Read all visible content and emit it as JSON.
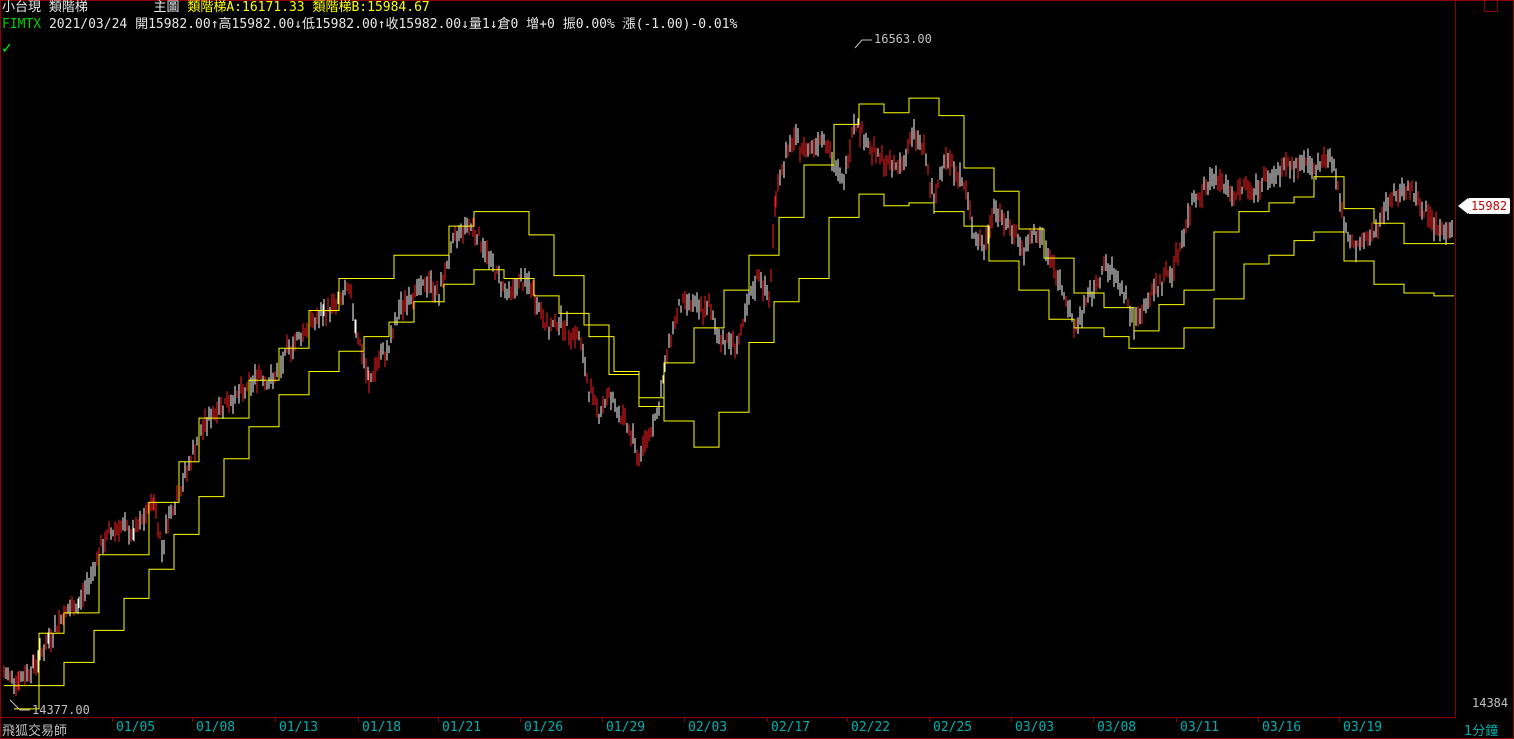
{
  "header": {
    "symbol": "小台現",
    "indicator_name": "類階梯",
    "panel": "主圖",
    "ind_a": "類階梯A:16171.33",
    "ind_b": "類階梯B:15984.67",
    "ticker": "FIMTX",
    "date": "2021/03/24",
    "open": "開15982.00",
    "high": "高15982.00",
    "low": "低15982.00",
    "close": "收15982.00",
    "vol": "量1",
    "oi": "倉0",
    "oi_chg": "增+0",
    "amp": "振0.00%",
    "chg": "漲(-1.00)-0.01%"
  },
  "footer": {
    "brand": "飛狐交易師",
    "interval": "1分鐘"
  },
  "annotations": {
    "high_label": "16563.00",
    "low_label": "14377.00",
    "last_price": "15982",
    "axis_bottom": "14384"
  },
  "colors": {
    "background": "#000000",
    "candle_up": "#ffffff",
    "candle_down": "#ff2020",
    "step_line": "#ffff00",
    "frame": "#8b0000",
    "date_text": "#00b0b0"
  },
  "chart_data": {
    "type": "line",
    "title": "",
    "x_labels": [
      "01/05",
      "01/08",
      "01/13",
      "01/18",
      "01/21",
      "01/26",
      "01/29",
      "02/03",
      "02/17",
      "02/22",
      "02/25",
      "03/03",
      "03/08",
      "03/11",
      "03/16",
      "03/19"
    ],
    "ylim": [
      14330,
      16620
    ],
    "price_series": [
      [
        0,
        14440
      ],
      [
        15,
        14420
      ],
      [
        30,
        14470
      ],
      [
        45,
        14560
      ],
      [
        60,
        14650
      ],
      [
        75,
        14680
      ],
      [
        85,
        14760
      ],
      [
        95,
        14860
      ],
      [
        105,
        14920
      ],
      [
        115,
        14950
      ],
      [
        130,
        14920
      ],
      [
        145,
        15000
      ],
      [
        150,
        15040
      ],
      [
        158,
        14870
      ],
      [
        165,
        14990
      ],
      [
        175,
        15060
      ],
      [
        185,
        15160
      ],
      [
        195,
        15260
      ],
      [
        205,
        15320
      ],
      [
        215,
        15360
      ],
      [
        225,
        15380
      ],
      [
        235,
        15400
      ],
      [
        245,
        15420
      ],
      [
        255,
        15480
      ],
      [
        265,
        15440
      ],
      [
        275,
        15480
      ],
      [
        285,
        15560
      ],
      [
        295,
        15600
      ],
      [
        305,
        15640
      ],
      [
        320,
        15680
      ],
      [
        335,
        15720
      ],
      [
        345,
        15760
      ],
      [
        352,
        15640
      ],
      [
        358,
        15540
      ],
      [
        365,
        15440
      ],
      [
        375,
        15520
      ],
      [
        385,
        15560
      ],
      [
        395,
        15690
      ],
      [
        405,
        15740
      ],
      [
        415,
        15760
      ],
      [
        425,
        15790
      ],
      [
        435,
        15740
      ],
      [
        445,
        15880
      ],
      [
        455,
        15960
      ],
      [
        465,
        15990
      ],
      [
        475,
        15940
      ],
      [
        485,
        15870
      ],
      [
        495,
        15800
      ],
      [
        505,
        15740
      ],
      [
        515,
        15790
      ],
      [
        525,
        15780
      ],
      [
        535,
        15700
      ],
      [
        545,
        15620
      ],
      [
        555,
        15660
      ],
      [
        565,
        15620
      ],
      [
        575,
        15600
      ],
      [
        585,
        15420
      ],
      [
        595,
        15340
      ],
      [
        605,
        15400
      ],
      [
        615,
        15340
      ],
      [
        625,
        15280
      ],
      [
        635,
        15180
      ],
      [
        645,
        15270
      ],
      [
        655,
        15360
      ],
      [
        665,
        15580
      ],
      [
        675,
        15700
      ],
      [
        685,
        15720
      ],
      [
        695,
        15690
      ],
      [
        705,
        15700
      ],
      [
        715,
        15600
      ],
      [
        725,
        15580
      ],
      [
        735,
        15580
      ],
      [
        745,
        15720
      ],
      [
        755,
        15820
      ],
      [
        765,
        15720
      ],
      [
        772,
        16100
      ],
      [
        780,
        16200
      ],
      [
        790,
        16280
      ],
      [
        800,
        16240
      ],
      [
        810,
        16260
      ],
      [
        820,
        16300
      ],
      [
        830,
        16180
      ],
      [
        840,
        16130
      ],
      [
        850,
        16350
      ],
      [
        860,
        16290
      ],
      [
        870,
        16230
      ],
      [
        880,
        16200
      ],
      [
        890,
        16180
      ],
      [
        900,
        16210
      ],
      [
        910,
        16300
      ],
      [
        920,
        16240
      ],
      [
        930,
        16050
      ],
      [
        940,
        16230
      ],
      [
        950,
        16180
      ],
      [
        960,
        16120
      ],
      [
        970,
        15960
      ],
      [
        980,
        15900
      ],
      [
        990,
        16050
      ],
      [
        1000,
        15990
      ],
      [
        1010,
        15970
      ],
      [
        1020,
        15880
      ],
      [
        1030,
        15960
      ],
      [
        1040,
        15920
      ],
      [
        1050,
        15830
      ],
      [
        1060,
        15760
      ],
      [
        1070,
        15620
      ],
      [
        1080,
        15700
      ],
      [
        1090,
        15760
      ],
      [
        1100,
        15840
      ],
      [
        1110,
        15810
      ],
      [
        1120,
        15760
      ],
      [
        1130,
        15640
      ],
      [
        1140,
        15700
      ],
      [
        1150,
        15760
      ],
      [
        1160,
        15800
      ],
      [
        1170,
        15840
      ],
      [
        1180,
        15960
      ],
      [
        1190,
        16080
      ],
      [
        1200,
        16110
      ],
      [
        1210,
        16150
      ],
      [
        1220,
        16120
      ],
      [
        1230,
        16080
      ],
      [
        1240,
        16120
      ],
      [
        1250,
        16100
      ],
      [
        1260,
        16140
      ],
      [
        1270,
        16150
      ],
      [
        1280,
        16190
      ],
      [
        1290,
        16180
      ],
      [
        1300,
        16200
      ],
      [
        1310,
        16160
      ],
      [
        1320,
        16230
      ],
      [
        1330,
        16190
      ],
      [
        1340,
        15980
      ],
      [
        1350,
        15900
      ],
      [
        1360,
        15920
      ],
      [
        1370,
        15960
      ],
      [
        1380,
        16040
      ],
      [
        1390,
        16080
      ],
      [
        1400,
        16120
      ],
      [
        1410,
        16090
      ],
      [
        1420,
        16040
      ],
      [
        1430,
        15980
      ],
      [
        1440,
        15960
      ],
      [
        1450,
        15982
      ]
    ],
    "step_a": [
      [
        0,
        14400
      ],
      [
        35,
        14580
      ],
      [
        60,
        14650
      ],
      [
        95,
        14850
      ],
      [
        145,
        15030
      ],
      [
        175,
        15170
      ],
      [
        195,
        15320
      ],
      [
        245,
        15450
      ],
      [
        275,
        15560
      ],
      [
        305,
        15690
      ],
      [
        335,
        15800
      ],
      [
        390,
        15880
      ],
      [
        445,
        15980
      ],
      [
        470,
        16030
      ],
      [
        525,
        15950
      ],
      [
        550,
        15810
      ],
      [
        580,
        15640
      ],
      [
        605,
        15470
      ],
      [
        635,
        15360
      ],
      [
        660,
        15510
      ],
      [
        690,
        15630
      ],
      [
        720,
        15760
      ],
      [
        745,
        15880
      ],
      [
        775,
        16010
      ],
      [
        800,
        16190
      ],
      [
        830,
        16330
      ],
      [
        855,
        16400
      ],
      [
        880,
        16370
      ],
      [
        905,
        16420
      ],
      [
        935,
        16360
      ],
      [
        960,
        16180
      ],
      [
        990,
        16100
      ],
      [
        1015,
        15970
      ],
      [
        1040,
        15870
      ],
      [
        1070,
        15750
      ],
      [
        1100,
        15700
      ],
      [
        1130,
        15620
      ],
      [
        1155,
        15710
      ],
      [
        1180,
        15760
      ],
      [
        1210,
        15960
      ],
      [
        1235,
        16030
      ],
      [
        1265,
        16060
      ],
      [
        1290,
        16080
      ],
      [
        1310,
        16150
      ],
      [
        1340,
        16040
      ],
      [
        1370,
        15990
      ],
      [
        1400,
        15920
      ],
      [
        1450,
        15920
      ]
    ],
    "step_b": [
      [
        10,
        14320
      ],
      [
        35,
        14400
      ],
      [
        60,
        14480
      ],
      [
        90,
        14590
      ],
      [
        120,
        14700
      ],
      [
        145,
        14800
      ],
      [
        170,
        14920
      ],
      [
        195,
        15050
      ],
      [
        220,
        15180
      ],
      [
        245,
        15290
      ],
      [
        275,
        15400
      ],
      [
        305,
        15480
      ],
      [
        335,
        15550
      ],
      [
        360,
        15600
      ],
      [
        385,
        15650
      ],
      [
        410,
        15720
      ],
      [
        440,
        15780
      ],
      [
        470,
        15830
      ],
      [
        500,
        15800
      ],
      [
        530,
        15740
      ],
      [
        555,
        15680
      ],
      [
        585,
        15600
      ],
      [
        610,
        15480
      ],
      [
        635,
        15390
      ],
      [
        660,
        15310
      ],
      [
        690,
        15220
      ],
      [
        715,
        15340
      ],
      [
        745,
        15580
      ],
      [
        770,
        15720
      ],
      [
        795,
        15800
      ],
      [
        825,
        16010
      ],
      [
        855,
        16090
      ],
      [
        880,
        16050
      ],
      [
        905,
        16060
      ],
      [
        930,
        16030
      ],
      [
        960,
        15980
      ],
      [
        985,
        15860
      ],
      [
        1015,
        15760
      ],
      [
        1045,
        15660
      ],
      [
        1070,
        15630
      ],
      [
        1100,
        15600
      ],
      [
        1125,
        15560
      ],
      [
        1155,
        15560
      ],
      [
        1180,
        15630
      ],
      [
        1210,
        15730
      ],
      [
        1240,
        15850
      ],
      [
        1265,
        15880
      ],
      [
        1290,
        15930
      ],
      [
        1310,
        15960
      ],
      [
        1340,
        15860
      ],
      [
        1370,
        15780
      ],
      [
        1400,
        15750
      ],
      [
        1430,
        15740
      ],
      [
        1450,
        15740
      ]
    ]
  }
}
